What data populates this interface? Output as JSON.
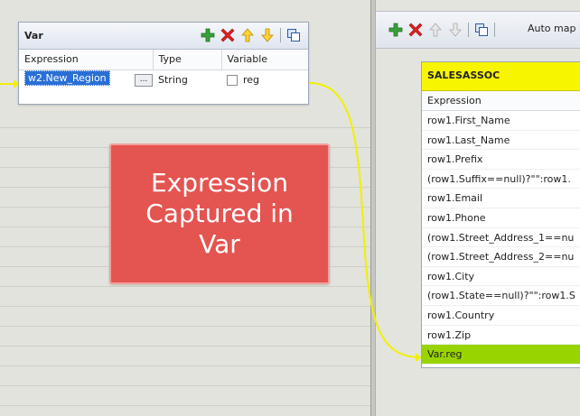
{
  "var_panel": {
    "title": "Var",
    "columns": [
      "Expression",
      "Type",
      "Variable"
    ],
    "row": {
      "expression": "w2.New_Region",
      "dots": "...",
      "type": "String",
      "variable": "reg"
    }
  },
  "callout": {
    "lines": [
      "Expression",
      "Captured in",
      "Var"
    ]
  },
  "right_toolbar": {
    "auto_map_label": "Auto map"
  },
  "output_table": {
    "title": "SALESASSOC",
    "column": "Expression",
    "rows": [
      "row1.First_Name",
      "row1.Last_Name",
      "row1.Prefix",
      "(row1.Suffix==null)?\"\":row1.",
      "row1.Email",
      "row1.Phone",
      "(row1.Street_Address_1==nu",
      "(row1.Street_Address_2==nu",
      "row1.City",
      "(row1.State==null)?\"\":row1.S",
      "row1.Country",
      "row1.Zip",
      "Var.reg"
    ]
  },
  "icons": {
    "add": "add-icon",
    "remove": "remove-icon",
    "move_up": "arrow-up-icon",
    "move_down": "arrow-down-icon",
    "edit": "edit-icon"
  },
  "colors": {
    "callout_bg": "#e45450",
    "title_bar_yellow": "#f8f500",
    "highlight_row_green": "#98d400",
    "selection_blue": "#2a6fd6",
    "connector_yellow": "#f0f000"
  }
}
